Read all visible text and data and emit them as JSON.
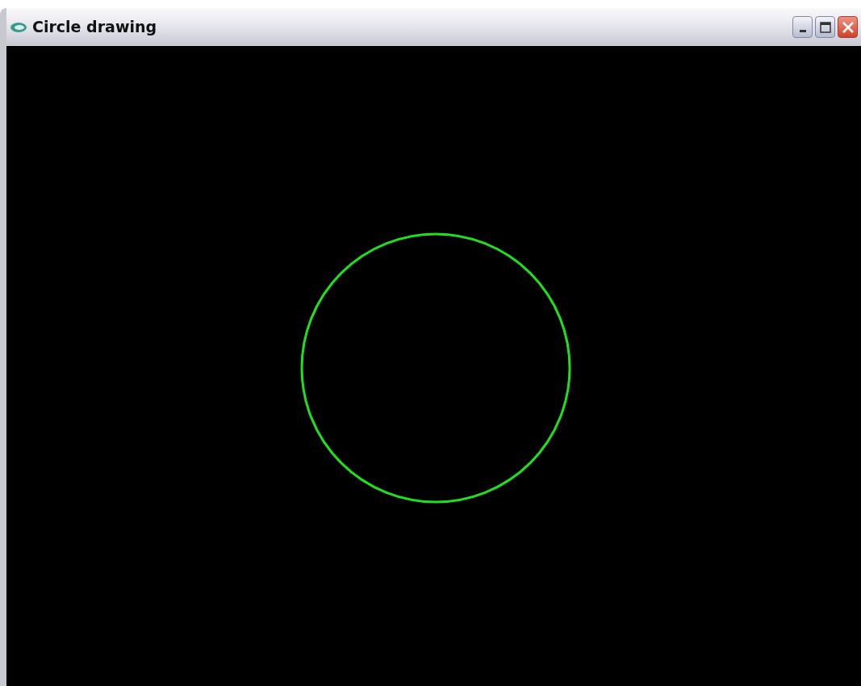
{
  "window": {
    "title": "Circle drawing"
  }
}
